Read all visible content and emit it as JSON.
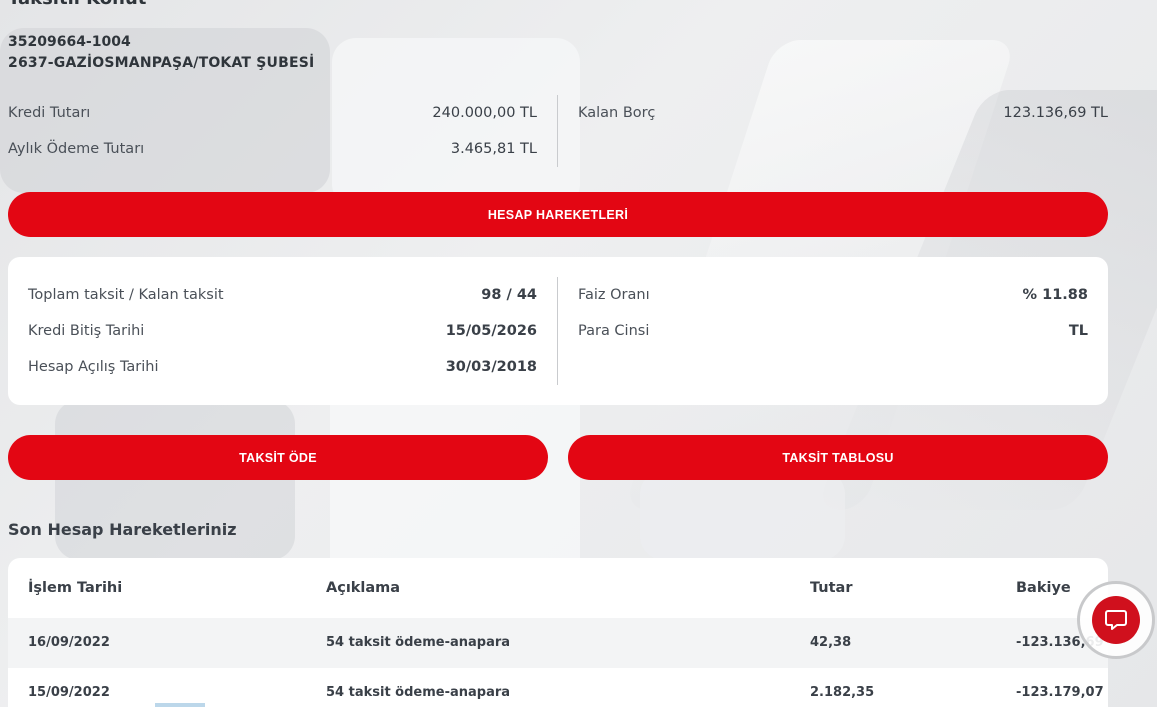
{
  "header": {
    "title": "Taksitli Konut",
    "account_number": "35209664-1004",
    "branch": "2637-GAZİOSMANPAŞA/TOKAT ŞUBESİ"
  },
  "summary": {
    "credit_amount_label": "Kredi Tutarı",
    "credit_amount_value": "240.000,00 TL",
    "monthly_payment_label": "Aylık Ödeme Tutarı",
    "monthly_payment_value": "3.465,81 TL",
    "remaining_debt_label": "Kalan Borç",
    "remaining_debt_value": "123.136,69 TL"
  },
  "buttons": {
    "account_movements": "HESAP HAREKETLERİ",
    "pay_installment": "TAKSİT ÖDE",
    "installment_table": "TAKSİT TABLOSU"
  },
  "details": {
    "installments_label": "Toplam taksit / Kalan taksit",
    "installments_value": "98 / 44",
    "end_date_label": "Kredi Bitiş Tarihi",
    "end_date_value": "15/05/2026",
    "open_date_label": "Hesap Açılış Tarihi",
    "open_date_value": "30/03/2018",
    "interest_label": "Faiz Oranı",
    "interest_value": "% 11.88",
    "currency_label": "Para Cinsi",
    "currency_value": "TL"
  },
  "transactions": {
    "section_title": "Son Hesap Hareketleriniz",
    "columns": [
      "İşlem Tarihi",
      "Açıklama",
      "Tutar",
      "Bakiye"
    ],
    "rows": [
      [
        "16/09/2022",
        "54 taksit ödeme-anapara",
        "42,38",
        "-123.136,69"
      ],
      [
        "15/09/2022",
        "54 taksit ödeme-anapara",
        "2.182,35",
        "-123.179,07"
      ]
    ]
  },
  "colors": {
    "brand_red": "#e30613",
    "text_dark": "#3a4048"
  },
  "icons": {
    "chat": "chat-bubble-icon"
  }
}
